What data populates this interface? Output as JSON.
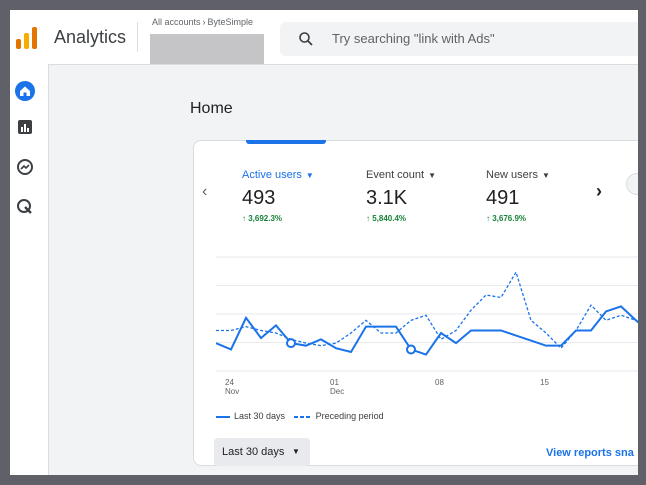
{
  "header": {
    "app_title": "Analytics",
    "breadcrumb": [
      "All accounts",
      "ByteSimple"
    ],
    "search_placeholder": "Try searching \"link with Ads\""
  },
  "rail": {
    "items": [
      "home-icon",
      "reports-icon",
      "explore-icon",
      "advertising-icon"
    ]
  },
  "page": {
    "title": "Home"
  },
  "card": {
    "metrics": [
      {
        "label": "Active users",
        "value": "493",
        "change": "3,692.3%",
        "active": true
      },
      {
        "label": "Event count",
        "value": "3.1K",
        "change": "5,840.4%",
        "active": false
      },
      {
        "label": "New users",
        "value": "491",
        "change": "3,676.9%",
        "active": false
      }
    ],
    "range_button": "Last 30 days",
    "view_link": "View reports sna"
  },
  "chart_data": {
    "type": "line",
    "x_ticks": [
      {
        "label": "24",
        "sub": "Nov",
        "index": 1
      },
      {
        "label": "01",
        "sub": "Dec",
        "index": 8
      },
      {
        "label": "08",
        "sub": "",
        "index": 15
      },
      {
        "label": "15",
        "sub": "",
        "index": 22
      }
    ],
    "n_points": 30,
    "series": [
      {
        "name": "Last 30 days",
        "style": "solid",
        "color": "#1a73e8",
        "values": [
          22,
          17,
          42,
          26,
          36,
          22,
          20,
          25,
          18,
          15,
          35,
          35,
          35,
          17,
          13,
          30,
          22,
          32,
          32,
          32,
          28,
          24,
          20,
          20,
          32,
          32,
          47,
          51,
          40,
          30,
          28
        ],
        "markers": [
          5,
          13
        ]
      },
      {
        "name": "Preceding period",
        "style": "dashed",
        "color": "#1a73e8",
        "values": [
          32,
          32,
          35,
          32,
          30,
          25,
          22,
          20,
          22,
          30,
          40,
          30,
          30,
          40,
          44,
          25,
          32,
          48,
          60,
          58,
          78,
          40,
          30,
          18,
          32,
          52,
          40,
          44,
          40,
          30,
          26
        ]
      }
    ],
    "ylim": [
      0,
      90
    ],
    "grid": true,
    "legend": "bottom-left"
  }
}
